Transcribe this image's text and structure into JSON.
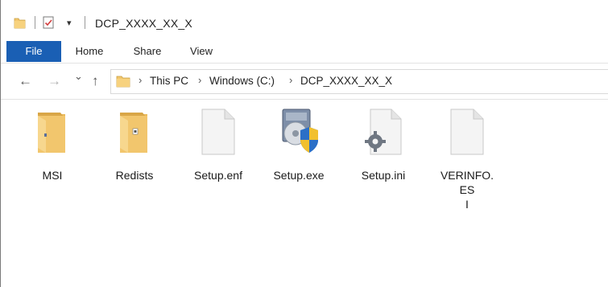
{
  "window": {
    "title": "DCP_XXXX_XX_X"
  },
  "ribbon": {
    "tabs": [
      {
        "label": "File"
      },
      {
        "label": "Home"
      },
      {
        "label": "Share"
      },
      {
        "label": "View"
      }
    ]
  },
  "address": {
    "crumbs": [
      "This PC",
      "Windows (C:)",
      "DCP_XXXX_XX_X"
    ],
    "separator": "›"
  },
  "nav": {
    "back": "←",
    "forward": "→",
    "recent": "⌄",
    "up": "↑"
  },
  "files": [
    {
      "name": "MSI",
      "icon": "folder-icon"
    },
    {
      "name": "Redists",
      "icon": "folder-icon"
    },
    {
      "name": "Setup.enf",
      "icon": "blank-file-icon"
    },
    {
      "name": "Setup.exe",
      "icon": "installer-exe-icon"
    },
    {
      "name": "Setup.ini",
      "icon": "settings-file-icon"
    },
    {
      "name": "VERINFO.ES\nI",
      "icon": "blank-file-icon"
    }
  ],
  "colors": {
    "file_tab": "#1a5fb4",
    "folder": "#f2c66d"
  }
}
